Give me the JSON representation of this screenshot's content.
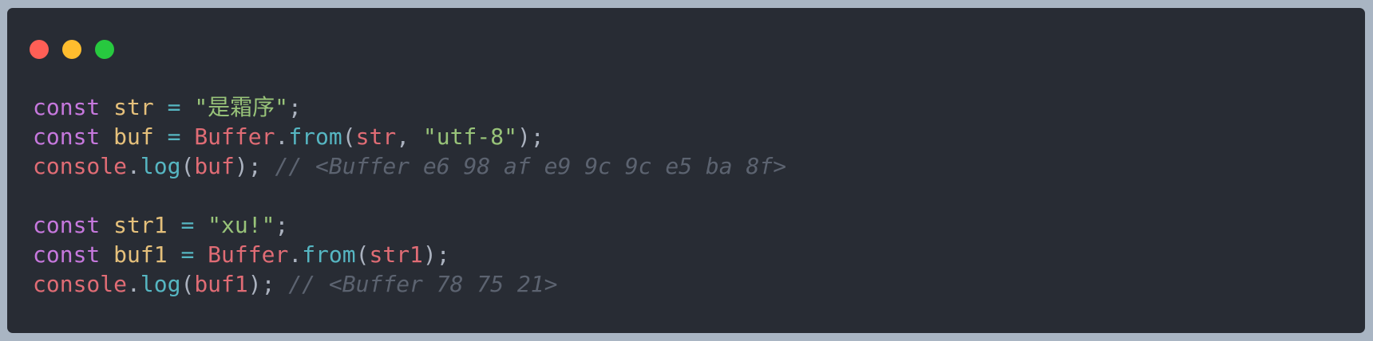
{
  "window": {
    "buttons": {
      "close_color": "#ff5f56",
      "minimize_color": "#ffbd2e",
      "maximize_color": "#27c93f"
    }
  },
  "code": {
    "lines": [
      {
        "tokens": [
          {
            "t": "const",
            "k": "kw"
          },
          {
            "t": " ",
            "k": "pun"
          },
          {
            "t": "str",
            "k": "var"
          },
          {
            "t": " ",
            "k": "pun"
          },
          {
            "t": "=",
            "k": "op"
          },
          {
            "t": " ",
            "k": "pun"
          },
          {
            "t": "\"是霜序\"",
            "k": "str"
          },
          {
            "t": ";",
            "k": "pun"
          }
        ]
      },
      {
        "tokens": [
          {
            "t": "const",
            "k": "kw"
          },
          {
            "t": " ",
            "k": "pun"
          },
          {
            "t": "buf",
            "k": "var"
          },
          {
            "t": " ",
            "k": "pun"
          },
          {
            "t": "=",
            "k": "op"
          },
          {
            "t": " ",
            "k": "pun"
          },
          {
            "t": "Buffer",
            "k": "cls"
          },
          {
            "t": ".",
            "k": "pun"
          },
          {
            "t": "from",
            "k": "fn2"
          },
          {
            "t": "(",
            "k": "pun"
          },
          {
            "t": "str",
            "k": "cls"
          },
          {
            "t": ", ",
            "k": "pun"
          },
          {
            "t": "\"utf-8\"",
            "k": "str"
          },
          {
            "t": ");",
            "k": "pun"
          }
        ]
      },
      {
        "tokens": [
          {
            "t": "console",
            "k": "cls"
          },
          {
            "t": ".",
            "k": "pun"
          },
          {
            "t": "log",
            "k": "fn2"
          },
          {
            "t": "(",
            "k": "pun"
          },
          {
            "t": "buf",
            "k": "cls"
          },
          {
            "t": "); ",
            "k": "pun"
          },
          {
            "t": "// <Buffer e6 98 af e9 9c 9c e5 ba 8f>",
            "k": "cmt"
          }
        ]
      },
      {
        "tokens": []
      },
      {
        "tokens": [
          {
            "t": "const",
            "k": "kw"
          },
          {
            "t": " ",
            "k": "pun"
          },
          {
            "t": "str1",
            "k": "var"
          },
          {
            "t": " ",
            "k": "pun"
          },
          {
            "t": "=",
            "k": "op"
          },
          {
            "t": " ",
            "k": "pun"
          },
          {
            "t": "\"xu!\"",
            "k": "str"
          },
          {
            "t": ";",
            "k": "pun"
          }
        ]
      },
      {
        "tokens": [
          {
            "t": "const",
            "k": "kw"
          },
          {
            "t": " ",
            "k": "pun"
          },
          {
            "t": "buf1",
            "k": "var"
          },
          {
            "t": " ",
            "k": "pun"
          },
          {
            "t": "=",
            "k": "op"
          },
          {
            "t": " ",
            "k": "pun"
          },
          {
            "t": "Buffer",
            "k": "cls"
          },
          {
            "t": ".",
            "k": "pun"
          },
          {
            "t": "from",
            "k": "fn2"
          },
          {
            "t": "(",
            "k": "pun"
          },
          {
            "t": "str1",
            "k": "cls"
          },
          {
            "t": ");",
            "k": "pun"
          }
        ]
      },
      {
        "tokens": [
          {
            "t": "console",
            "k": "cls"
          },
          {
            "t": ".",
            "k": "pun"
          },
          {
            "t": "log",
            "k": "fn2"
          },
          {
            "t": "(",
            "k": "pun"
          },
          {
            "t": "buf1",
            "k": "cls"
          },
          {
            "t": "); ",
            "k": "pun"
          },
          {
            "t": "// <Buffer 78 75 21>",
            "k": "cmt"
          }
        ]
      }
    ]
  }
}
